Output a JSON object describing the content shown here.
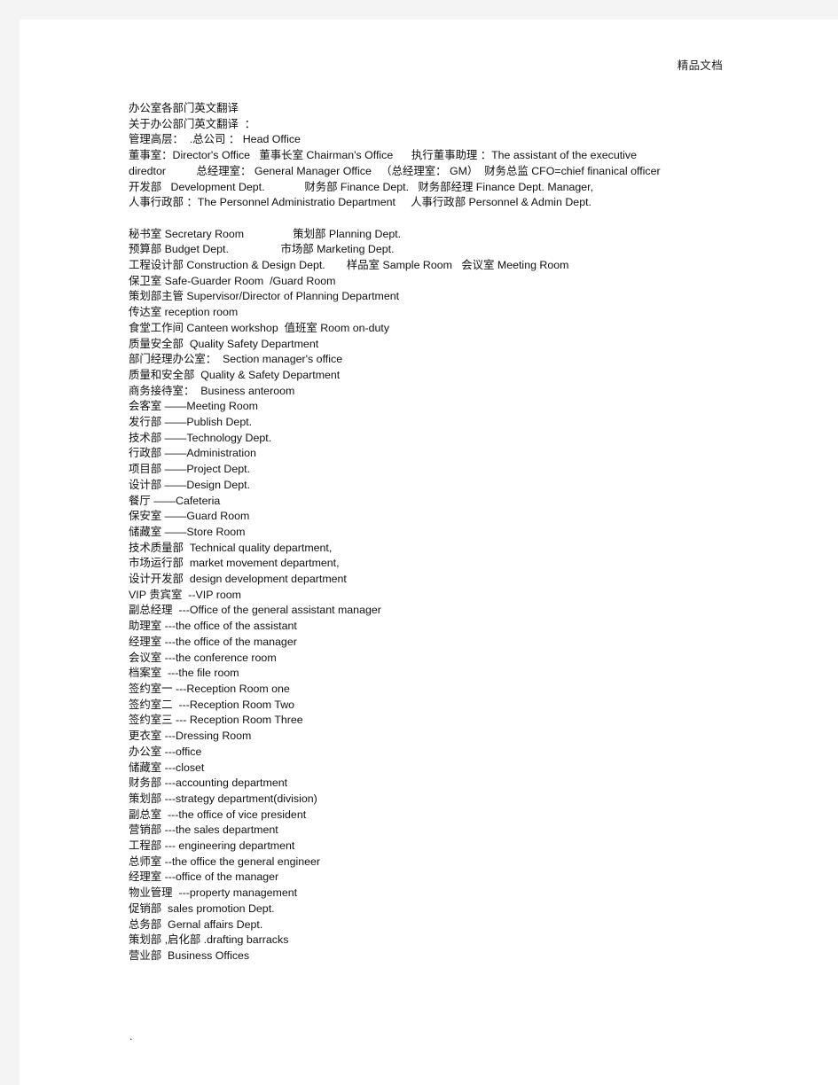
{
  "page": {
    "header_text": "精品文档",
    "background_color": "#f4f4f4",
    "paper_color": "#ffffff",
    "text_color": "#111111",
    "trailing_mark": "."
  },
  "document": {
    "title": "办公室各部门英文翻译",
    "lines": [
      "办公室各部门英文翻译",
      "关于办公部门英文翻译  ：",
      "管理高层：  .总公司 ： Head Office",
      "董事室：Director's Office   董事长室 Chairman's Office      执行董事助理 ：The assistant of the executive",
      "diredtor          总经理室： General Manager Office   （总经理室： GM）  财务总监 CFO=chief finanical officer",
      "开发部   Development Dept.             财务部 Finance Dept.   财务部经理 Finance Dept. Manager,",
      "人事行政部 ：The Personnel Administratio Department     人事行政部 Personnel & Admin Dept.",
      "",
      "秘书室 Secretary Room                策划部 Planning Dept.",
      "预算部 Budget Dept.                 市场部 Marketing Dept.",
      "工程设计部 Construction & Design Dept.       样品室 Sample Room   会议室 Meeting Room",
      "保卫室 Safe-Guarder Room  /Guard Room",
      "策划部主管 Supervisor/Director of Planning Department",
      "传达室 reception room",
      "食堂工作间 Canteen workshop  值班室 Room on-duty",
      "质量安全部  Quality Safety Department",
      "部门经理办公室：  Section manager's office",
      "质量和安全部  Quality & Safety Department",
      "商务接待室：  Business anteroom",
      "会客室 ——Meeting Room",
      "发行部 ——Publish Dept.",
      "技术部 ——Technology Dept.",
      "行政部 ——Administration",
      "项目部 ——Project Dept.",
      "设计部 ——Design Dept.",
      "餐厅 ——Cafeteria",
      "保安室 ——Guard Room",
      "储藏室 ——Store Room",
      "技术质量部  Technical quality department,",
      "市场运行部  market movement department,",
      "设计开发部  design development department",
      "VIP 贵宾室  --VIP room",
      "副总经理  ---Office of the general assistant manager",
      "助理室 ---the office of the assistant",
      "经理室 ---the office of the manager",
      "会议室 ---the conference room",
      "档案室  ---the file room",
      "签约室一 ---Reception Room one",
      "签约室二  ---Reception Room Two",
      "签约室三 --- Reception Room Three",
      "更衣室 ---Dressing Room",
      "办公室 ---office",
      "储藏室 ---closet",
      "财务部 ---accounting department",
      "策划部 ---strategy department(division)",
      "副总室  ---the office of vice president",
      "营销部 ---the sales department",
      "工程部 --- engineering department",
      "总师室 --the office the general engineer",
      "经理室 ---office of the manager",
      "物业管理  ---property management",
      "促销部  sales promotion Dept.",
      "总务部  Gernal affairs Dept.",
      "策划部 ,启化部 .drafting barracks",
      "营业部  Business Offices"
    ]
  }
}
